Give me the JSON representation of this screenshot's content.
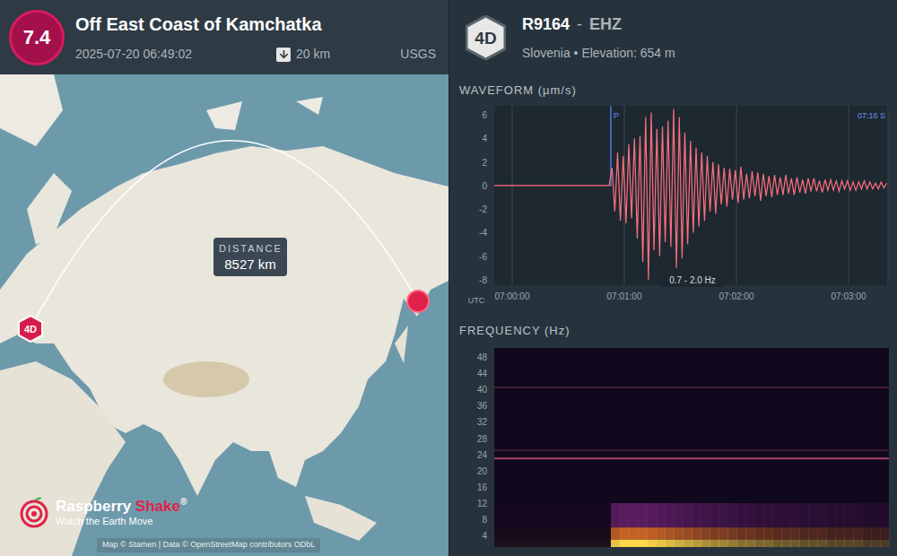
{
  "event": {
    "magnitude": "7.4",
    "title": "Off East Coast of Kamchatka",
    "datetime": "2025-07-20 06:49:02",
    "depth": "20 km",
    "source": "USGS"
  },
  "map": {
    "distance_label": "DISTANCE",
    "distance": "8527 km",
    "station_code": "4D",
    "attribution": "Map © Stamen | Data © OpenStreetMap contributors ODbL",
    "logo": {
      "name_a": "Raspberry",
      "name_b": "Shake",
      "mark": "®",
      "tagline": "Watch the Earth Move"
    }
  },
  "station": {
    "network": "4D",
    "code": "R9164",
    "separator": "-",
    "channel": "EHZ",
    "subtitle": "Slovenia • Elevation: 654 m"
  },
  "waveform": {
    "title": "WAVEFORM (µm/s)",
    "y_ticks": [
      "6",
      "4",
      "2",
      "0",
      "-2",
      "-4",
      "-6",
      "-8"
    ],
    "x_ticks": [
      "07:00:00",
      "07:01:00",
      "07:02:00",
      "07:03:00"
    ],
    "axis_label": "UTC",
    "filter": "0.7 - 2.0 Hz",
    "markers": [
      {
        "label": "P",
        "at_seconds": 62.4
      }
    ],
    "end_marker": "07:16 S",
    "sample_seconds": 1.5,
    "values": [
      0,
      0,
      0,
      0,
      0,
      0,
      0,
      0,
      0,
      0,
      0,
      0,
      0,
      0,
      0,
      0,
      0,
      0,
      0,
      0,
      0,
      0,
      0,
      0,
      0,
      0,
      0,
      0,
      0,
      0,
      0,
      0,
      0,
      0,
      0,
      0,
      0,
      0,
      0,
      0,
      0,
      0,
      1.5,
      -2.2,
      2.8,
      -3.0,
      2.5,
      -3.2,
      3.5,
      -2.8,
      4.0,
      -4.5,
      4.2,
      -6.5,
      5.8,
      -8.0,
      6.2,
      -5.5,
      4.8,
      -6.0,
      5.0,
      -4.8,
      5.5,
      -5.2,
      6.5,
      -7.0,
      5.8,
      -6.2,
      4.5,
      -5.0,
      3.8,
      -4.0,
      3.2,
      -3.5,
      2.8,
      -3.0,
      2.5,
      -2.2,
      2.0,
      -2.4,
      1.8,
      -1.6,
      1.5,
      -1.8,
      1.4,
      -1.2,
      1.3,
      -1.5,
      1.6,
      -1.2,
      1.0,
      -1.1,
      1.2,
      -0.9,
      1.1,
      -1.3,
      1.0,
      -0.9,
      0.8,
      -1.0,
      0.9,
      -0.8,
      0.7,
      -0.8,
      0.9,
      -0.7,
      0.6,
      -0.8,
      0.7,
      -0.6,
      0.5,
      -0.7,
      0.6,
      -0.5,
      0.6,
      -0.5,
      0.4,
      -0.6,
      0.5,
      -0.4,
      0.5,
      -0.4,
      0.4,
      -0.5,
      0.4,
      -0.3,
      0.4,
      -0.4,
      0.3,
      -0.4,
      0.3,
      -0.3,
      0.4,
      -0.3,
      0.3,
      -0.3,
      0.2,
      -0.3,
      0.3,
      -0.2,
      0.2
    ]
  },
  "spectrogram": {
    "title": "FREQUENCY (Hz)",
    "y_ticks": [
      "48",
      "44",
      "40",
      "36",
      "32",
      "28",
      "24",
      "20",
      "16",
      "12",
      "8",
      "4"
    ],
    "energy": [
      0.05,
      0.05,
      0.05,
      0.05,
      0.05,
      0.05,
      0.05,
      0.05,
      0.05,
      0.05,
      0.05,
      0.05,
      0.05,
      0.9,
      1,
      1,
      1,
      0.95,
      0.9,
      0.85,
      0.8,
      0.75,
      0.7,
      0.65,
      0.6,
      0.6,
      0.55,
      0.5,
      0.5,
      0.45,
      0.45,
      0.4,
      0.4,
      0.4,
      0.35,
      0.35,
      0.35,
      0.3,
      0.3,
      0.3,
      0.3,
      0.25,
      0.25,
      0.25
    ],
    "lines": [
      {
        "hz": 23,
        "level": 0.85
      },
      {
        "hz": 25,
        "level": 0.25
      },
      {
        "hz": 40.5,
        "level": 0.3
      }
    ]
  }
}
